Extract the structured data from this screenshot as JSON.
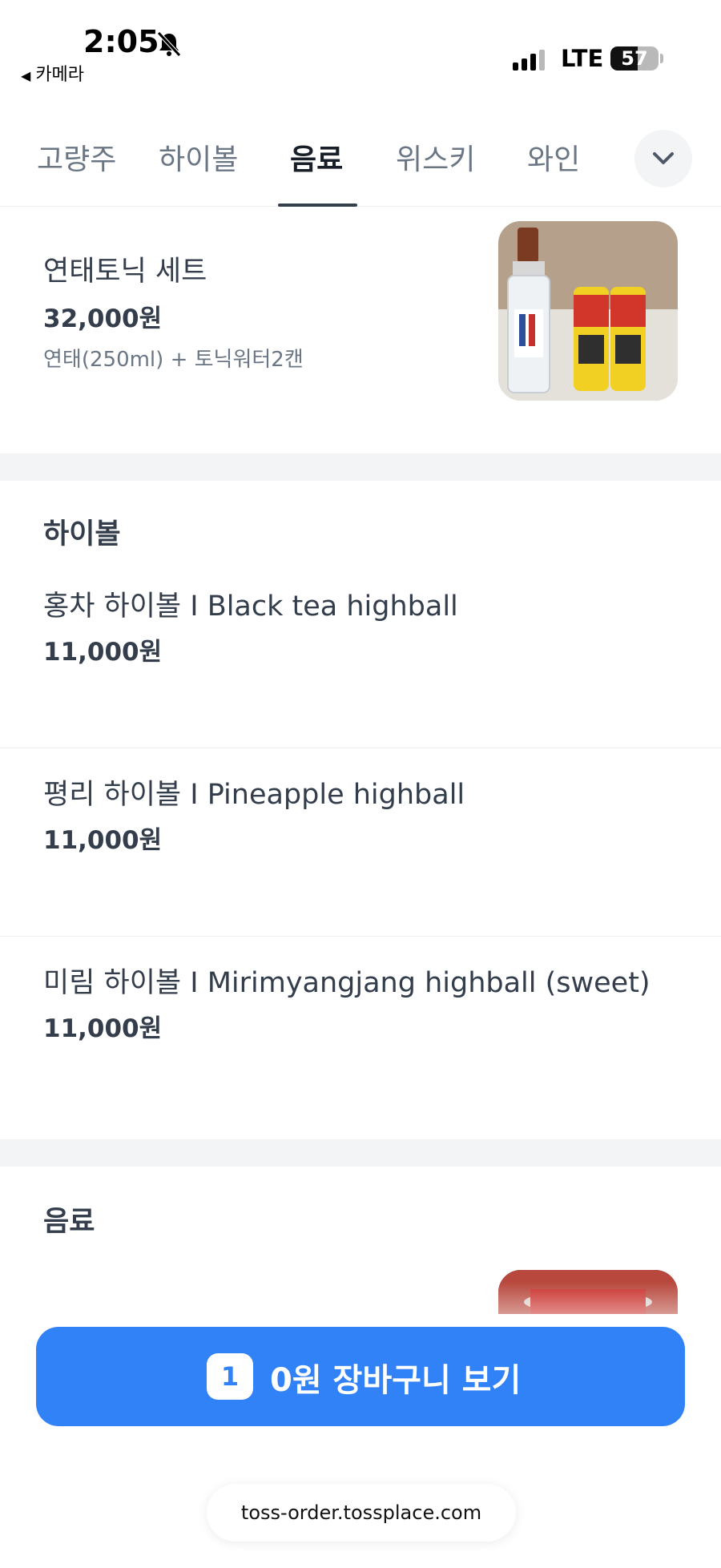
{
  "status_bar": {
    "time": "2:05",
    "back_app": "카메라",
    "network": "LTE",
    "battery": "57",
    "battery_level_pct": 57,
    "icons": [
      "silent-bell-icon",
      "cellular-signal-icon",
      "battery-icon"
    ]
  },
  "tabs": [
    {
      "label": "고량주",
      "active": false
    },
    {
      "label": "하이볼",
      "active": false
    },
    {
      "label": "음료",
      "active": true
    },
    {
      "label": "위스키",
      "active": false
    },
    {
      "label": "와인",
      "active": false
    }
  ],
  "tab_more_icon": "chevron-down-icon",
  "top_item": {
    "name": "연태토닉 세트",
    "price": "32,000원",
    "description": "연태(250ml) + 토닉워터2캔",
    "image": "bottle-and-cans-photo"
  },
  "sections": [
    {
      "title": "하이볼",
      "items": [
        {
          "name": "홍차 하이볼 I Black tea highball",
          "price": "11,000원"
        },
        {
          "name": "평리 하이볼 I Pineapple highball",
          "price": "11,000원"
        },
        {
          "name": "미림 하이볼 I Mirimyangjang highball (sweet)",
          "price": "11,000원"
        }
      ]
    },
    {
      "title": "음료",
      "items": []
    }
  ],
  "cart": {
    "count": "1",
    "label": "0원 장바구니 보기"
  },
  "browser": {
    "url": "toss-order.tossplace.com"
  },
  "colors": {
    "accent": "#3182f6",
    "text": "#333d4b",
    "muted": "#6b7684",
    "section_gap": "#f2f4f6"
  }
}
